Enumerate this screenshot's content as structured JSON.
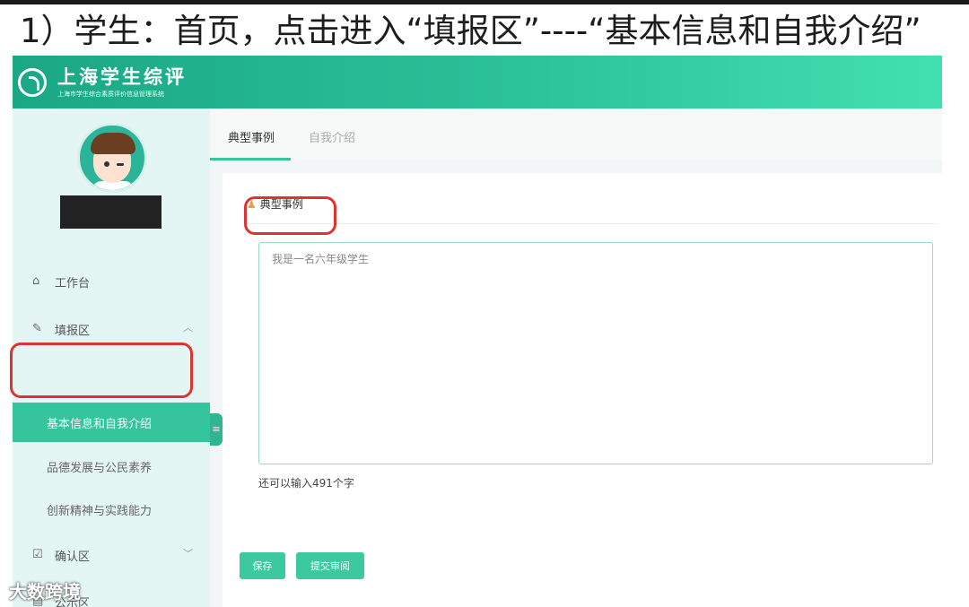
{
  "caption": "1）学生：首页，点击进入“填报区”----“基本信息和自我介绍”",
  "header": {
    "brand": "上海学生综评",
    "subtitle": "上海市学生综合素质评价信息管理系统"
  },
  "sidebar": {
    "items": [
      {
        "label": "工作台",
        "icon": "home-icon"
      },
      {
        "label": "填报区",
        "icon": "edit-icon",
        "chevron": "︿"
      },
      {
        "label": "确认区",
        "icon": "checkbox-icon",
        "chevron": "﹀"
      },
      {
        "label": "公示区",
        "icon": "board-icon"
      }
    ],
    "sub_items": [
      {
        "label": "基本信息和自我介绍"
      },
      {
        "label": "品德发展与公民素养"
      },
      {
        "label": "创新精神与实践能力"
      }
    ],
    "collapse_icon": "≡"
  },
  "main": {
    "tabs": [
      {
        "label": "典型事例"
      },
      {
        "label": "自我介绍"
      }
    ],
    "panel": {
      "tab_icon": "♟",
      "tab_label": "典型事例",
      "textarea_value": "我是一名六年级学生",
      "counter": "还可以输入491个字",
      "save_label": "保存",
      "submit_label": "提交审阅"
    }
  },
  "watermark": "大数跨境",
  "colors": {
    "accent": "#36c49d",
    "header_start": "#1aa785",
    "header_end": "#42e0b0",
    "highlight": "#dd3333"
  }
}
